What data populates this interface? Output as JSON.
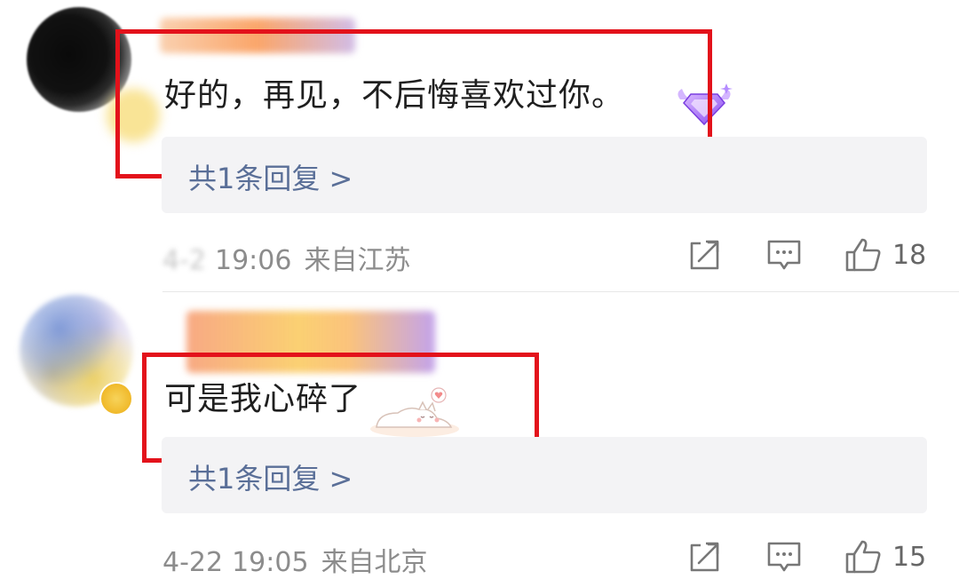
{
  "comments": [
    {
      "text": "好的，再见，不后悔喜欢过你。",
      "reply_link": "共1条回复 >",
      "date": "4-2",
      "time": "19:06",
      "location": "来自江苏",
      "likes": "18"
    },
    {
      "text": "可是我心碎了",
      "reply_link": "共1条回复 >",
      "date": "4-22",
      "time": "19:05",
      "location": "来自北京",
      "likes": "15"
    }
  ],
  "icons": {
    "share": "share-icon",
    "comment": "comment-icon",
    "like": "thumbs-up-icon"
  },
  "colors": {
    "highlight": "#e3121b",
    "reply_link": "#5a6f98",
    "meta_text": "#8c8c8c"
  }
}
